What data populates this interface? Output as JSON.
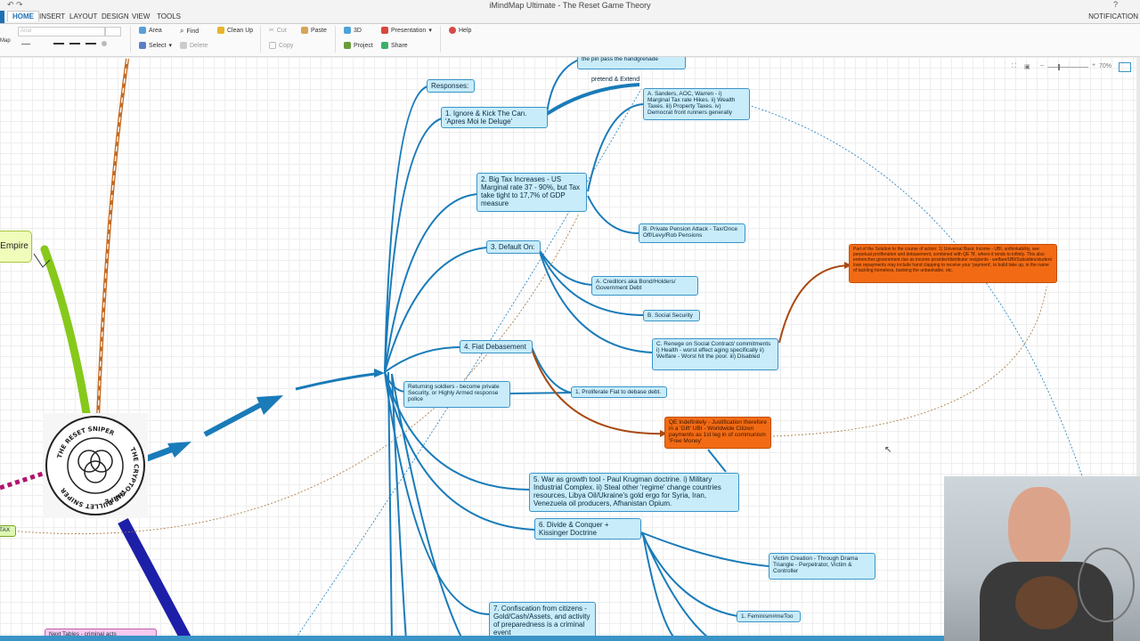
{
  "window": {
    "title": "iMindMap Ultimate - The Reset Game Theory",
    "notifications": "NOTIFICATION",
    "help_glyph": "?"
  },
  "menu": {
    "tabs": [
      "HOME",
      "INSERT",
      "LAYOUT",
      "DESIGN",
      "VIEW",
      "TOOLS"
    ]
  },
  "ribbon": {
    "side_label": "Map",
    "area": "Area",
    "select": "Select",
    "find": "Find",
    "delete": "Delete",
    "clean_up": "Clean Up",
    "cut": "Cut",
    "copy": "Copy",
    "paste": "Paste",
    "three_d": "3D",
    "project": "Project",
    "presentation": "Presentation",
    "share": "Share",
    "help": "Help",
    "font_placeholder": "Arial"
  },
  "zoom": {
    "level": "70%",
    "minus": "–",
    "plus": "+"
  },
  "map": {
    "central_fragment": "Empire",
    "tax_tag": "TAX",
    "partial_top": "the pin pass the handgrenade",
    "responses": "Responses:",
    "pretend_extend": "pretend & Extend",
    "branches": {
      "b1": "1. Ignore & Kick The Can. 'Apres Moi le Deluge'",
      "b1a": "A. Sanders, AOC, Warren - i) Marginal Tax rate Hikes. ii) Wealth Taxes. iii) Property Taxes. iv) Democrat front runners generally",
      "b2": "2. Big Tax Increases - US Marginal rate 37 - 90%, but Tax take tight to 17,7% of GDP measure",
      "b2b": "B. Private Pension Attack - Tax/Once Off/Levy/Rob Pensions",
      "b3": "3. Default On:",
      "b3a": "A. Creditors aka Bond/Holders/ Government Debt",
      "b3b": "B. Social Security",
      "b3c": "C. Renege on Social Contract/ commitments i) Health - worst effect aging specifically ii) Welfare - Worst hit the poor. iii) Disabled",
      "ubi": "Part of the Solution to the course of action: 1) Universal Basic Income - UBI, unthinkability, see perpetual proliferation and debasement, combined with QE 'N', where it tends to infinity. This also entrenches government rise as income provider/distributor recipients - welfare/UBI/Subsidies/student loan repayments may include hand clapping to receive your 'payment', to build take up, in the name of tackling homeless, banking the unbankable, etc.",
      "b4": "4. Fiat Debasement",
      "soldiers": "Returning soldiers - become private Security, or Highly Armed response police",
      "b4_1": "1. Proliferate Fiat to debase debt.",
      "qe": "QE Indefinitely - Justification therefore in a 'Gift' UBI - Worldwide Citizen payments as 1st leg in of communism 'Free Money'",
      "b5": "5. War as growth tool - Paul Krugman doctrine. i) Military Industrial Complex. ii) Steal other 'regime' change countries resources, Libya Oil/Ukraine's gold ergo for Syria, Iran, Venezuela oil producers, Afhanistan Opium.",
      "b6": "6. Divide & Conquer + Kissinger Doctrine",
      "victim": "Victim Creation - Through Drama Triangle - Perpetrator, Victim & Controller",
      "feminism": "1. Feminism#meToo",
      "b7": "7. Confiscation from citizens - Gold/Cash/Assets, and activity of preparedness is a criminal event",
      "pink_partial": "Next Tables - criminal acts"
    }
  },
  "seal": {
    "text_top": "THE RESET SNIPER",
    "text_right": "THE CRYPTO SNIPER",
    "text_bottom": "THE BULLET SNIPER"
  },
  "colors": {
    "branch_blue": "#1a7bb9",
    "topic_fill": "#c8ecf9",
    "orange": "#f26b14",
    "connector_brown": "#a84a12",
    "green_branch": "#86c91a",
    "navy_branch": "#1d1fa8",
    "magenta_dash": "#b0136e"
  }
}
